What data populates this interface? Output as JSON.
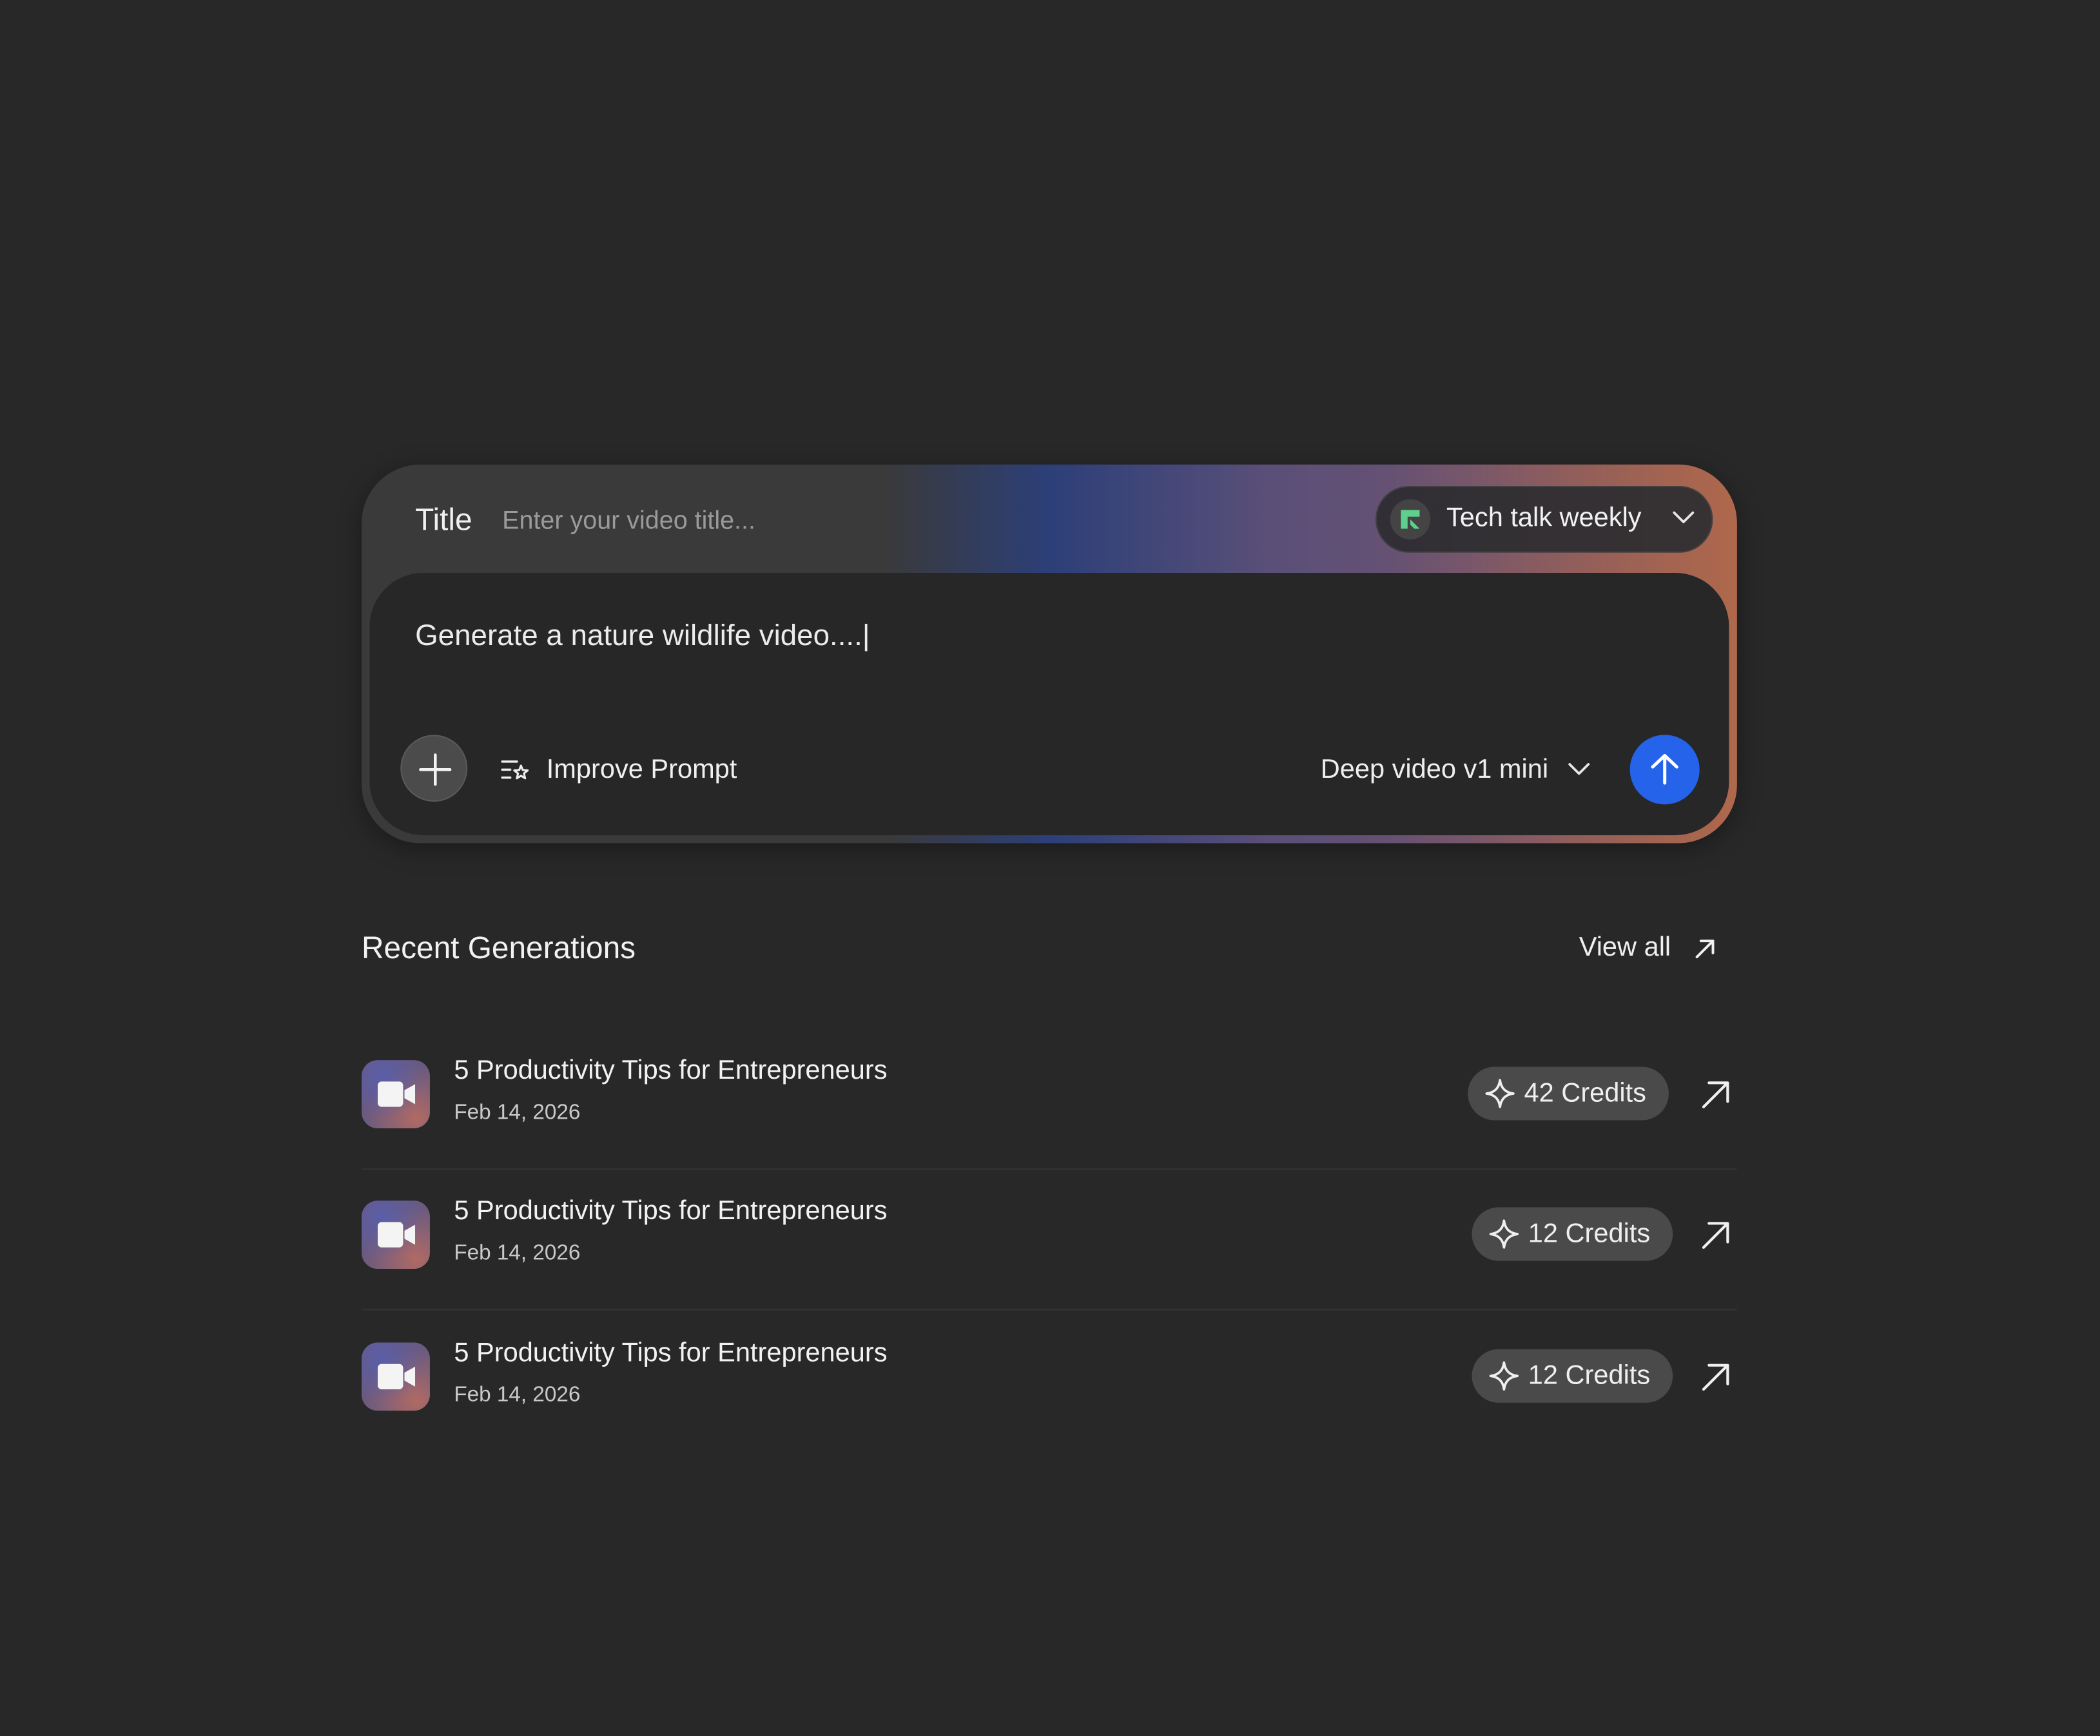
{
  "composer": {
    "title_label": "Title",
    "title_placeholder": "Enter your video title...",
    "channel": {
      "name": "Tech talk weekly",
      "accent": "#5fcf8f"
    },
    "prompt_text": "Generate a nature wildlife video....|",
    "improve_prompt_label": "Improve Prompt",
    "model_label": "Deep video v1 mini",
    "send_color": "#2563eb",
    "icons": {
      "add": "plus-icon",
      "improve": "sparkle-list-icon",
      "model_dropdown": "chevron-down-icon",
      "send": "arrow-up-icon"
    }
  },
  "recent": {
    "heading": "Recent Generations",
    "view_all_label": "View all",
    "items": [
      {
        "title": "5 Productivity Tips for Entrepreneurs",
        "date": "Feb 14, 2026",
        "credits": "42 Credits"
      },
      {
        "title": "5 Productivity Tips for Entrepreneurs",
        "date": "Feb 14, 2026",
        "credits": "12 Credits"
      },
      {
        "title": "5 Productivity Tips for Entrepreneurs",
        "date": "Feb 14, 2026",
        "credits": "12 Credits"
      }
    ]
  }
}
